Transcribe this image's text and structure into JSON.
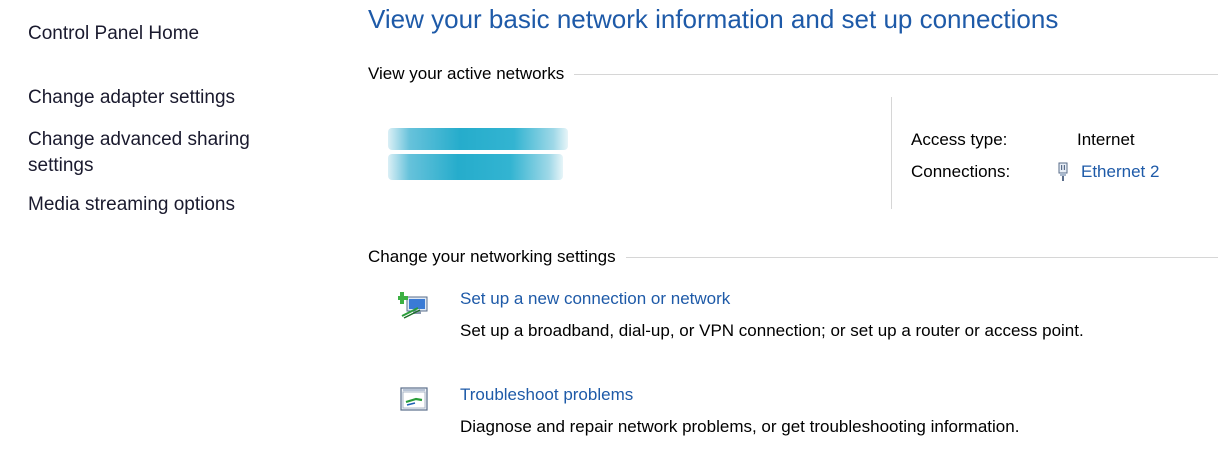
{
  "sidebar": {
    "items": [
      {
        "label": "Control Panel Home"
      },
      {
        "label": "Change adapter settings"
      },
      {
        "label": "Change advanced sharing settings"
      },
      {
        "label": "Media streaming options"
      }
    ]
  },
  "main": {
    "title": "View your basic network information and set up connections",
    "active_section": {
      "heading": "View your active networks",
      "access_type_label": "Access type:",
      "access_type_value": "Internet",
      "connections_label": "Connections:",
      "connection_name": "Ethernet 2",
      "connection_icon": "ethernet-icon"
    },
    "change_section": {
      "heading": "Change your networking settings",
      "tasks": [
        {
          "icon": "new-connection-icon",
          "link": "Set up a new connection or network",
          "description": "Set up a broadband, dial-up, or VPN connection; or set up a router or access point."
        },
        {
          "icon": "troubleshoot-icon",
          "link": "Troubleshoot problems",
          "description": "Diagnose and repair network problems, or get troubleshooting information."
        }
      ]
    }
  },
  "colors": {
    "link": "#1e5aa8",
    "title": "#1e5aa8",
    "divider": "#d6d6d6",
    "network_blur": "#1aa8c9"
  }
}
